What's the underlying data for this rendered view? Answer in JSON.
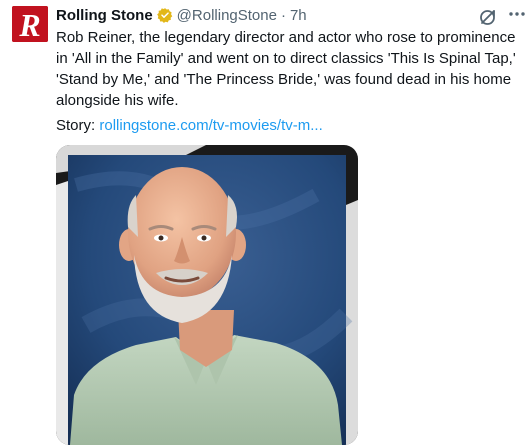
{
  "tweet": {
    "avatar_icon": "rolling-stone-logo",
    "display_name": "Rolling Stone",
    "verified_icon": "verified-gold-badge-icon",
    "handle": "@RollingStone",
    "separator": "·",
    "time": "7h",
    "grok_icon": "grok-icon",
    "more_icon": "more-options-icon",
    "text": "Rob Reiner, the legendary director and actor who rose to prominence in 'All in the Family' and went on to direct classics 'This Is Spinal Tap,' 'Stand by Me,' and 'The Princess Bride,' was found dead in his home alongside his wife.",
    "story_label": "Story:",
    "story_link": "rollingstone.com/tv-movies/tv-m...",
    "image": "photo-portrait"
  },
  "colors": {
    "brand_red": "#c1121f",
    "link_blue": "#1d9bf0",
    "muted_gray": "#536471",
    "verified_gold": "#e2b719"
  }
}
